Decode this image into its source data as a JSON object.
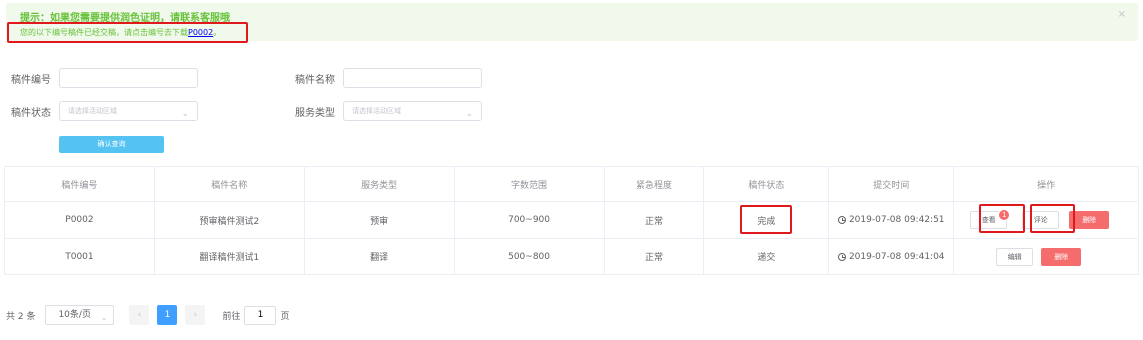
{
  "alert": {
    "title": "提示：如果您需要提供润色证明，请联系客服哦",
    "message_prefix": "您的以下编号稿件已经交稿，请点击编号去下载",
    "manuscript_link": "P0002",
    "message_suffix": "。",
    "close": "×"
  },
  "form": {
    "manuscript_no_label": "稿件编号",
    "manuscript_name_label": "稿件名称",
    "status_label": "稿件状态",
    "status_placeholder": "请选择活动区域",
    "service_type_label": "服务类型",
    "service_type_placeholder": "请选择活动区域",
    "query_button": "确认查询"
  },
  "table": {
    "headers": [
      "稿件编号",
      "稿件名称",
      "服务类型",
      "字数范围",
      "紧急程度",
      "稿件状态",
      "提交时间",
      "操作"
    ],
    "rows": [
      {
        "no": "P0002",
        "name": "预审稿件测试2",
        "service": "预审",
        "words": "700~900",
        "urgency": "正常",
        "status": "完成",
        "time": "2019-07-08 09:42:51",
        "actions": {
          "view": "查看",
          "badge": "1",
          "comment": "评论",
          "delete": "删除"
        }
      },
      {
        "no": "T0001",
        "name": "翻译稿件测试1",
        "service": "翻译",
        "words": "500~800",
        "urgency": "正常",
        "status": "递交",
        "time": "2019-07-08 09:41:04",
        "actions": {
          "edit": "编辑",
          "delete": "删除"
        }
      }
    ]
  },
  "pagination": {
    "total": "共 2 条",
    "page_size": "10条/页",
    "prev": "‹",
    "current_page": "1",
    "next": "›",
    "goto_prefix": "前往",
    "goto_value": "1",
    "goto_suffix": "页"
  },
  "colors": {
    "success": "#67c23a",
    "primary": "#409eff",
    "danger": "#f56c6c",
    "highlight_box": "#e0191d",
    "query_button": "#55c3f2"
  }
}
